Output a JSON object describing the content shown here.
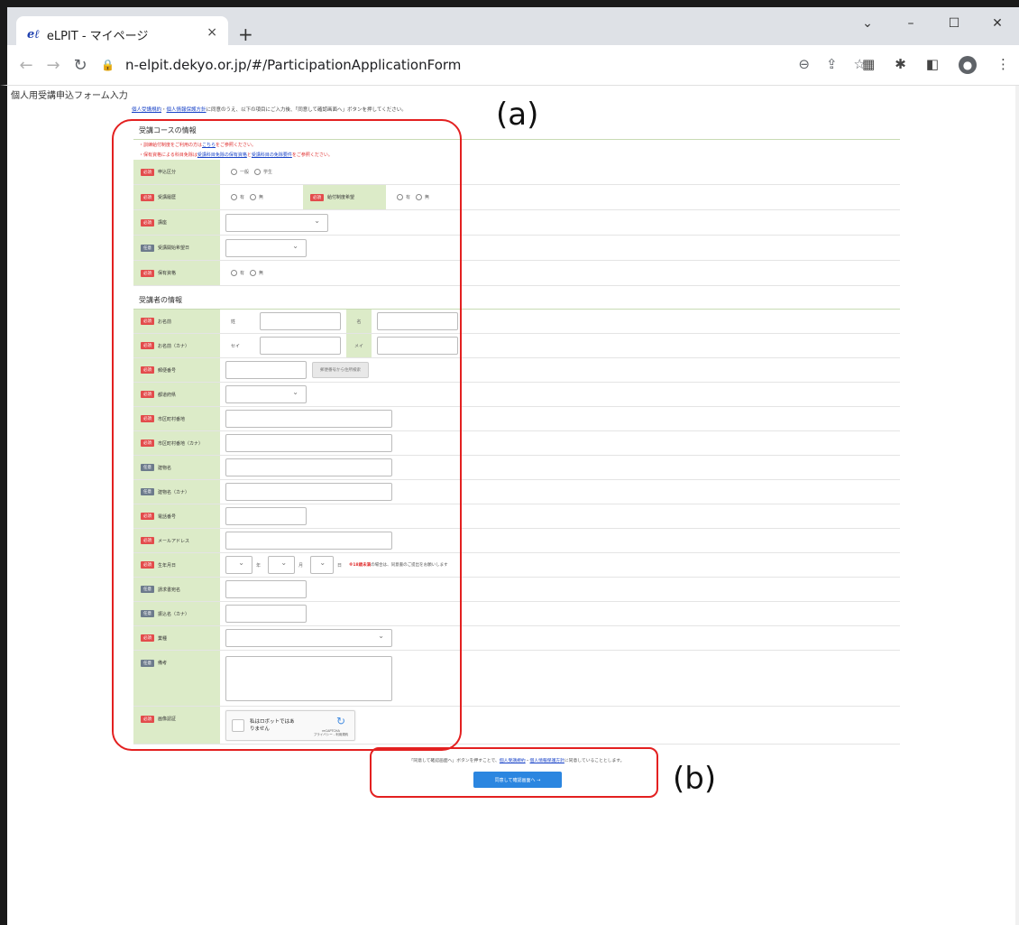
{
  "browser": {
    "tab_title": "eLPIT - マイページ",
    "favicon_text": "eℓ",
    "tab_close": "×",
    "new_tab": "+",
    "window_controls": [
      "⌄",
      "–",
      "☐",
      "✕"
    ],
    "url": "n-elpit.dekyo.or.jp/#/ParticipationApplicationForm"
  },
  "page": {
    "title": "個人用受講申込フォーム入力",
    "intro": {
      "link1": "個人受講規約",
      "sep": "・",
      "link2": "個人情報保護方針",
      "text": "に同意のうえ、以下の項目にご入力後、「同意して確認画面へ」ボタンを押してください。"
    }
  },
  "course_section": {
    "heading": "受講コースの情報",
    "notice1_pre": "・訓練給付制度をご利用の方は",
    "notice1_link": "こちら",
    "notice1_post": "をご参照ください。",
    "notice2_pre": "・保有資格による科目免除は",
    "notice2_link1": "受講科目免除の保有資格",
    "notice2_mid": "と",
    "notice2_link2": "受講科目の免除要件",
    "notice2_post": "をご参照ください。",
    "rows": {
      "application_type": {
        "badge": "必須",
        "label": "申込区分",
        "opt1": "一般",
        "opt2": "学生"
      },
      "attendance_history": {
        "badge": "必須",
        "label": "受講履歴",
        "opt1": "有",
        "opt2": "無"
      },
      "benefit_wish": {
        "label": "給付制度希望",
        "opt1": "有",
        "opt2": "無"
      },
      "course": {
        "badge": "必須",
        "label": "講座"
      },
      "start_date": {
        "badge": "任意",
        "label": "受講開始希望日"
      },
      "certification": {
        "badge": "必須",
        "label": "保有資格",
        "opt1": "有",
        "opt2": "無"
      }
    }
  },
  "student_section": {
    "heading": "受講者の情報",
    "rows": {
      "name": {
        "badge": "必須",
        "label": "お名前",
        "sub1": "姓",
        "sub2": "名"
      },
      "name_kana": {
        "badge": "必須",
        "label": "お名前（カナ）",
        "sub1": "セイ",
        "sub2": "メイ"
      },
      "postal": {
        "badge": "必須",
        "label": "郵便番号",
        "button": "郵便番号から住所検索"
      },
      "prefecture": {
        "badge": "必須",
        "label": "都道府県"
      },
      "city": {
        "badge": "必須",
        "label": "市区町村番地"
      },
      "city_kana": {
        "badge": "必須",
        "label": "市区町村番地（カナ）"
      },
      "building": {
        "badge": "任意",
        "label": "建物名"
      },
      "building_kana": {
        "badge": "任意",
        "label": "建物名（カナ）"
      },
      "phone": {
        "badge": "必須",
        "label": "電話番号"
      },
      "email": {
        "badge": "必須",
        "label": "メールアドレス"
      },
      "birthdate": {
        "badge": "必須",
        "label": "生年月日",
        "year": "年",
        "month": "月",
        "day": "日",
        "warn_red": "※18歳未満",
        "warn_rest": "の場合は、同意書のご提出をお願いします"
      },
      "invoice": {
        "badge": "任意",
        "label": "請求書宛名"
      },
      "bank_name": {
        "badge": "任意",
        "label": "振込名（カナ）"
      },
      "occupation": {
        "badge": "必須",
        "label": "業種"
      },
      "remarks": {
        "badge": "任意",
        "label": "備考"
      },
      "captcha": {
        "badge": "必須",
        "label": "画像認証",
        "text": "私はロボットではありません",
        "brand": "reCAPTCHA",
        "footer": "プライバシー - 利用規約"
      }
    }
  },
  "footer": {
    "consent_pre": "「同意して確認画面へ」ボタンを押すことで、",
    "consent_link1": "個人受講規約",
    "consent_sep": "・",
    "consent_link2": "個人情報保護方針",
    "consent_post": "に同意していることとします。",
    "button": "同意して確認画面へ →"
  },
  "annotations": {
    "a": "(a)",
    "b": "(b)",
    "color": "#e32020"
  }
}
